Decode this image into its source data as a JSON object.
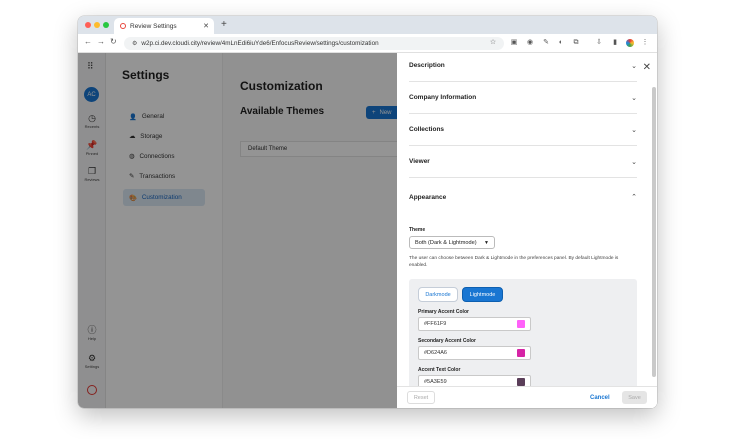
{
  "browser": {
    "tab_title": "Review Settings",
    "url": "w2p.ci.dev.cloudi.city/review/4mLnEdi6iuYde6/EnfocusReview/settings/customization"
  },
  "rail": {
    "avatar": "AC",
    "items": [
      {
        "label": "Recents",
        "icon": "clock-icon"
      },
      {
        "label": "Pinned",
        "icon": "pin-icon"
      },
      {
        "label": "Reviews",
        "icon": "copy-icon"
      },
      {
        "label": "Help",
        "icon": "help-icon"
      },
      {
        "label": "Settings",
        "icon": "gear-icon"
      }
    ]
  },
  "settings": {
    "title": "Settings",
    "nav": [
      {
        "label": "General",
        "icon": "user-icon"
      },
      {
        "label": "Storage",
        "icon": "cloud-icon"
      },
      {
        "label": "Connections",
        "icon": "globe-icon"
      },
      {
        "label": "Transactions",
        "icon": "pen-icon"
      },
      {
        "label": "Customization",
        "icon": "palette-icon"
      }
    ]
  },
  "main": {
    "title": "Customization",
    "subtitle": "Available Themes",
    "new_label": "New",
    "theme_row": "Default Theme"
  },
  "panel": {
    "sections": [
      "Description",
      "Company Information",
      "Collections",
      "Viewer",
      "Appearance"
    ],
    "theme_label": "Theme",
    "theme_value": "Both (Dark & Lightmode)",
    "help_text": "The user can choose between Dark & Lightmode in the preferences panel. By default Lightmode is enabled.",
    "darkmode_label": "Darkmode",
    "lightmode_label": "Lightmode",
    "colors": [
      {
        "label": "Primary Accent Color",
        "value": "#FF61F9",
        "swatch": "#FF61F9"
      },
      {
        "label": "Secondary Accent Color",
        "value": "#D624A6",
        "swatch": "#D624A6"
      },
      {
        "label": "Accent Text Color",
        "value": "#5A3E59",
        "swatch": "#5A3E59"
      }
    ],
    "reset_label": "Reset",
    "cancel_label": "Cancel",
    "save_label": "Save"
  }
}
